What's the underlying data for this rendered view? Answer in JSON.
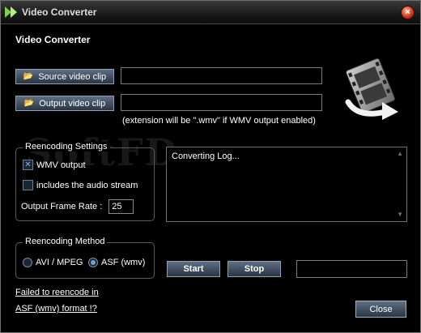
{
  "window": {
    "title": "Video Converter",
    "close_glyph": "×",
    "app_icon": "play-arrows-icon"
  },
  "header": "Video Converter",
  "watermark": "SoftFD",
  "source": {
    "label": "Source video clip",
    "value": "",
    "icon": "folder-open-icon"
  },
  "output": {
    "label": "Output video clip",
    "value": "",
    "icon": "folder-open-icon"
  },
  "extension_note": "(extension will be \".wmv\" if WMV output enabled)",
  "reencoding_settings": {
    "legend": "Reencoding Settings",
    "wmv_output": {
      "label": "WMV output",
      "checked": true
    },
    "audio_stream": {
      "label": "includes the audio stream",
      "checked": false
    },
    "frame_rate": {
      "label": "Output Frame Rate :",
      "value": "25"
    }
  },
  "log": {
    "text": "Converting Log...",
    "scroll_up": "▲",
    "scroll_down": "▼"
  },
  "reencoding_method": {
    "legend": "Reencoding Method",
    "options": [
      {
        "label": "AVI / MPEG",
        "selected": false
      },
      {
        "label": "ASF (wmv)",
        "selected": true
      }
    ]
  },
  "actions": {
    "start": "Start",
    "stop": "Stop",
    "status_value": "",
    "close": "Close"
  },
  "help_link": {
    "line1": "Failed to reencode in",
    "line2": "ASF (wmv) format !?"
  },
  "colors": {
    "background": "#000000",
    "button_top": "#5f6f82",
    "button_bottom": "#2b3642",
    "accent_blue": "#6fa0d8",
    "close_red": "#d33a1a"
  }
}
